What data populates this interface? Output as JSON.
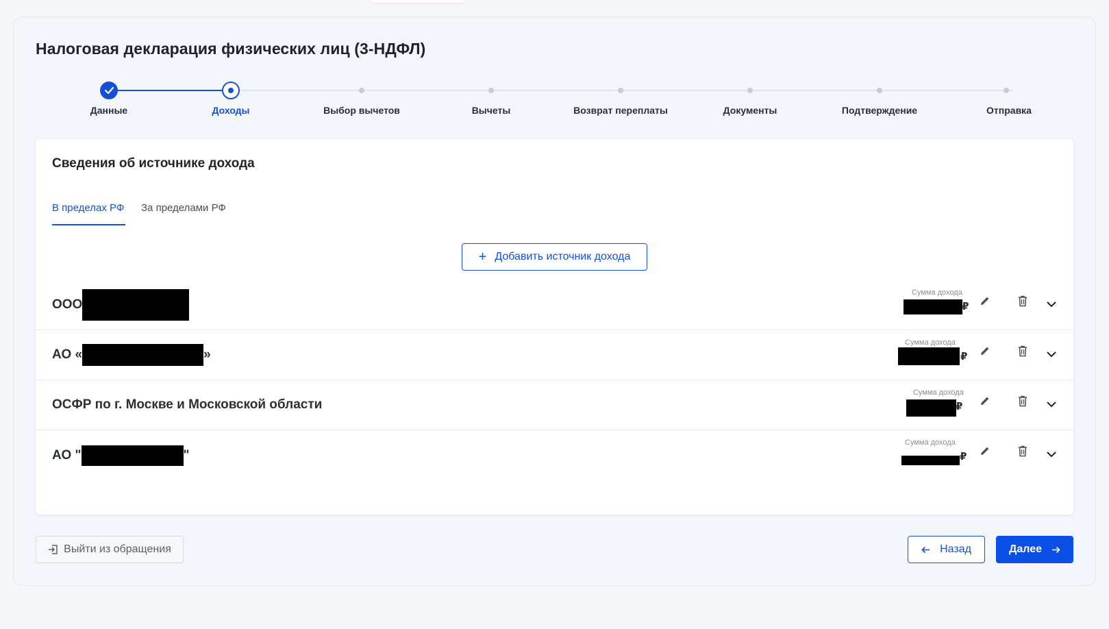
{
  "page": {
    "title": "Налоговая декларация физических лиц (3-НДФЛ)"
  },
  "stepper": {
    "steps": [
      {
        "label": "Данные",
        "state": "done"
      },
      {
        "label": "Доходы",
        "state": "current"
      },
      {
        "label": "Выбор вычетов",
        "state": "todo"
      },
      {
        "label": "Вычеты",
        "state": "todo"
      },
      {
        "label": "Возврат переплаты",
        "state": "todo"
      },
      {
        "label": "Документы",
        "state": "todo"
      },
      {
        "label": "Подтверждение",
        "state": "todo"
      },
      {
        "label": "Отправка",
        "state": "todo"
      }
    ]
  },
  "income_card": {
    "title": "Сведения об источнике дохода",
    "tabs": [
      {
        "label": "В пределах РФ",
        "active": true
      },
      {
        "label": "За пределами РФ",
        "active": false
      }
    ],
    "add_button": {
      "icon": "plus-icon",
      "label": "Добавить источник дохода"
    },
    "amount_label": "Сумма дохода",
    "currency": "₽",
    "sources": [
      {
        "prefix": "ООО",
        "suffix": "",
        "redacted": true
      },
      {
        "prefix": "АО «",
        "suffix": "»",
        "redacted": true
      },
      {
        "prefix": "ОСФР по г. Москве и Московской области",
        "suffix": "",
        "redacted": false
      },
      {
        "prefix": "АО \"",
        "suffix": "\"",
        "redacted": true
      }
    ]
  },
  "footer": {
    "exit_label": "Выйти из обращения",
    "back_label": "Назад",
    "next_label": "Далее"
  },
  "colors": {
    "accent": "#1450d6",
    "primary_button": "#0a4fe6",
    "background": "#f4f6fa"
  }
}
